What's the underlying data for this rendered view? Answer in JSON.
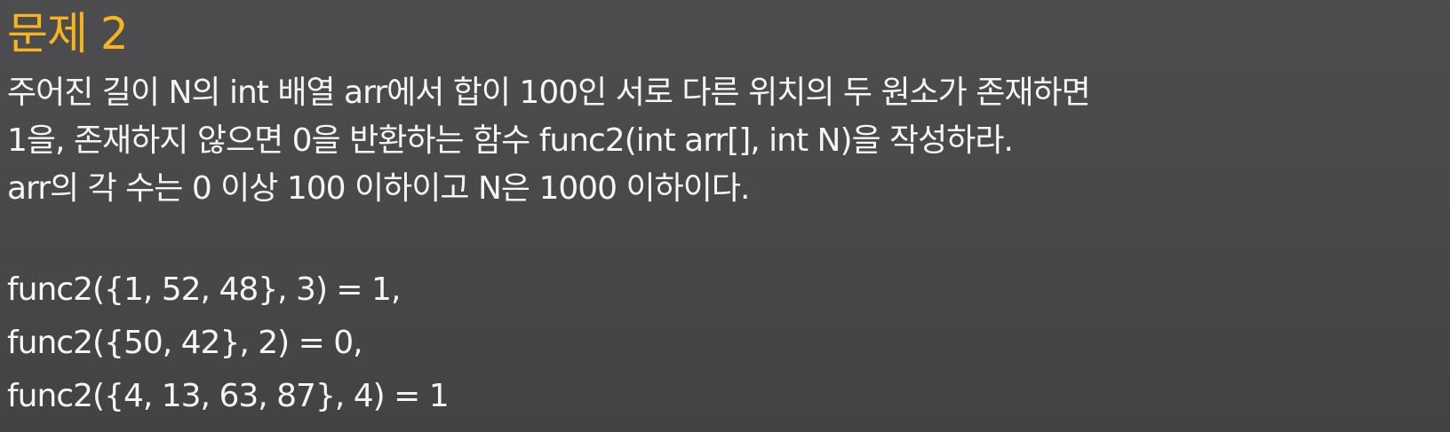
{
  "slide": {
    "title": "문제 2",
    "description": [
      "주어진 길이 N의 int 배열 arr에서 합이 100인 서로 다른 위치의 두 원소가 존재하면",
      "1을, 존재하지 않으면 0을 반환하는 함수 func2(int arr[], int N)을 작성하라.",
      "arr의 각 수는 0 이상 100 이하이고 N은 1000 이하이다."
    ],
    "examples": [
      "func2({1, 52, 48}, 3) = 1,",
      "func2({50, 42}, 2) = 0,",
      "func2({4, 13, 63, 87}, 4) = 1"
    ],
    "colors": {
      "background": "#4a494b",
      "title": "#f6b41d",
      "text": "#f5f5f5"
    }
  }
}
